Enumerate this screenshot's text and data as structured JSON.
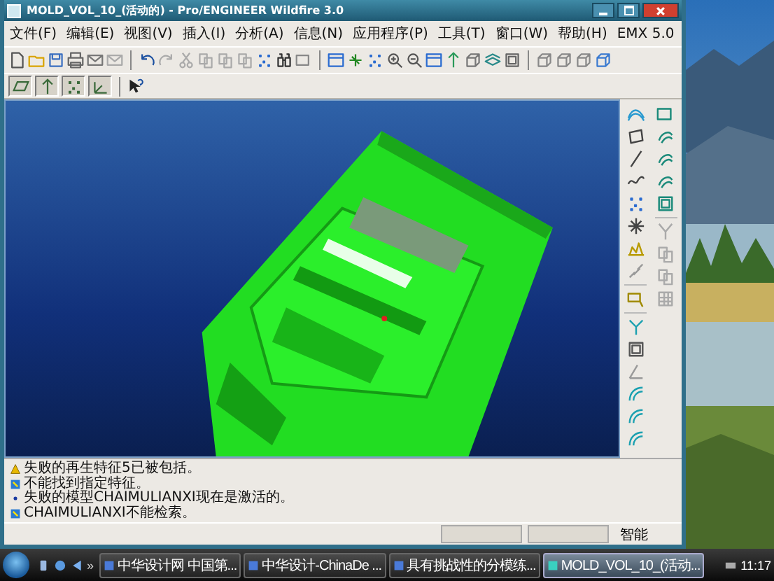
{
  "window": {
    "title": "MOLD_VOL_10_(活动的) - Pro/ENGINEER Wildfire 3.0"
  },
  "menu": [
    "文件(F)",
    "编辑(E)",
    "视图(V)",
    "插入(I)",
    "分析(A)",
    "信息(N)",
    "应用程序(P)",
    "工具(T)",
    "窗口(W)",
    "帮助(H)",
    "EMX 5.0"
  ],
  "datum_toggles": [
    {
      "on": true
    },
    {
      "on": true
    },
    {
      "on": true
    },
    {
      "on": true
    }
  ],
  "messages": [
    {
      "kind": "warning",
      "text": "失败的再生特征5已被包括。"
    },
    {
      "kind": "error",
      "text": "不能找到指定特征。"
    },
    {
      "kind": "bullet",
      "text": "失败的模型CHAIMULIANXI现在是激活的。"
    },
    {
      "kind": "error",
      "text": "CHAIMULIANXI不能检索。"
    }
  ],
  "status_bar": {
    "filter": "智能"
  },
  "taskbar": {
    "overflow": "»",
    "tasks": [
      {
        "label": "中华设计网 中国第...",
        "selected": false
      },
      {
        "label": "中华设计-ChinaDe ...",
        "selected": false
      },
      {
        "label": "具有挑战性的分模练...",
        "selected": false
      },
      {
        "label": "MOLD_VOL_10_(活动...",
        "selected": true
      }
    ],
    "clock": "11:17"
  }
}
